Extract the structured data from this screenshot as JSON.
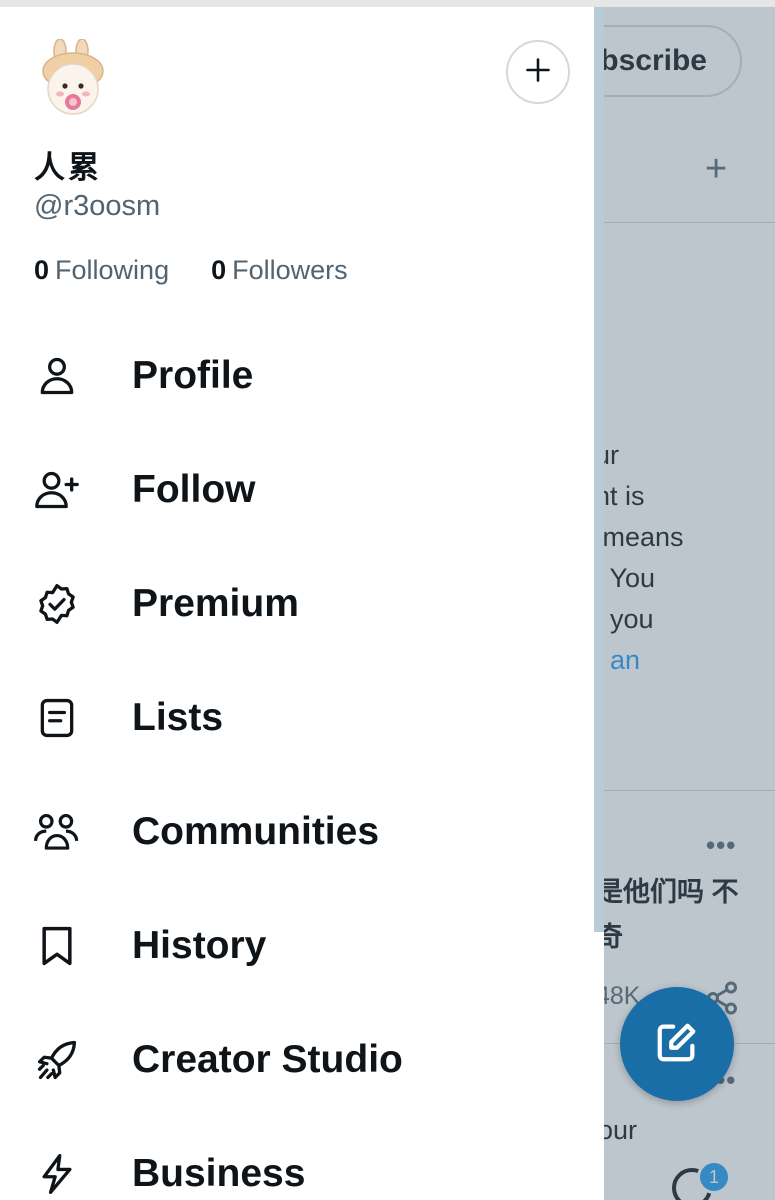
{
  "background": {
    "subscribe_label": "bscribe",
    "plus_glyph": "+",
    "notice_lines": [
      "ur",
      "nt is",
      " means",
      ". You",
      "f you"
    ],
    "notice_link": "t an",
    "more_glyph": "•••",
    "tweet_text_lines": [
      "是他们吗 不",
      "奇"
    ],
    "stat_text": "48K",
    "bottom_text": "our",
    "notification_count": "1"
  },
  "drawer": {
    "display_name": "人累",
    "handle": "@r3oosm",
    "following_count": "0",
    "following_label": "Following",
    "followers_count": "0",
    "followers_label": "Followers",
    "nav_items": [
      {
        "label": "Profile",
        "icon": "person-icon"
      },
      {
        "label": "Follow",
        "icon": "person-add-icon"
      },
      {
        "label": "Premium",
        "icon": "verified-badge-icon"
      },
      {
        "label": "Lists",
        "icon": "list-icon"
      },
      {
        "label": "Communities",
        "icon": "communities-icon"
      },
      {
        "label": "History",
        "icon": "bookmark-icon"
      },
      {
        "label": "Creator Studio",
        "icon": "rocket-icon"
      },
      {
        "label": "Business",
        "icon": "lightning-icon"
      }
    ]
  },
  "colors": {
    "accent": "#1d9bf0",
    "fab": "#1a6ea8",
    "text_primary": "#0f1419",
    "text_secondary": "#536471"
  }
}
